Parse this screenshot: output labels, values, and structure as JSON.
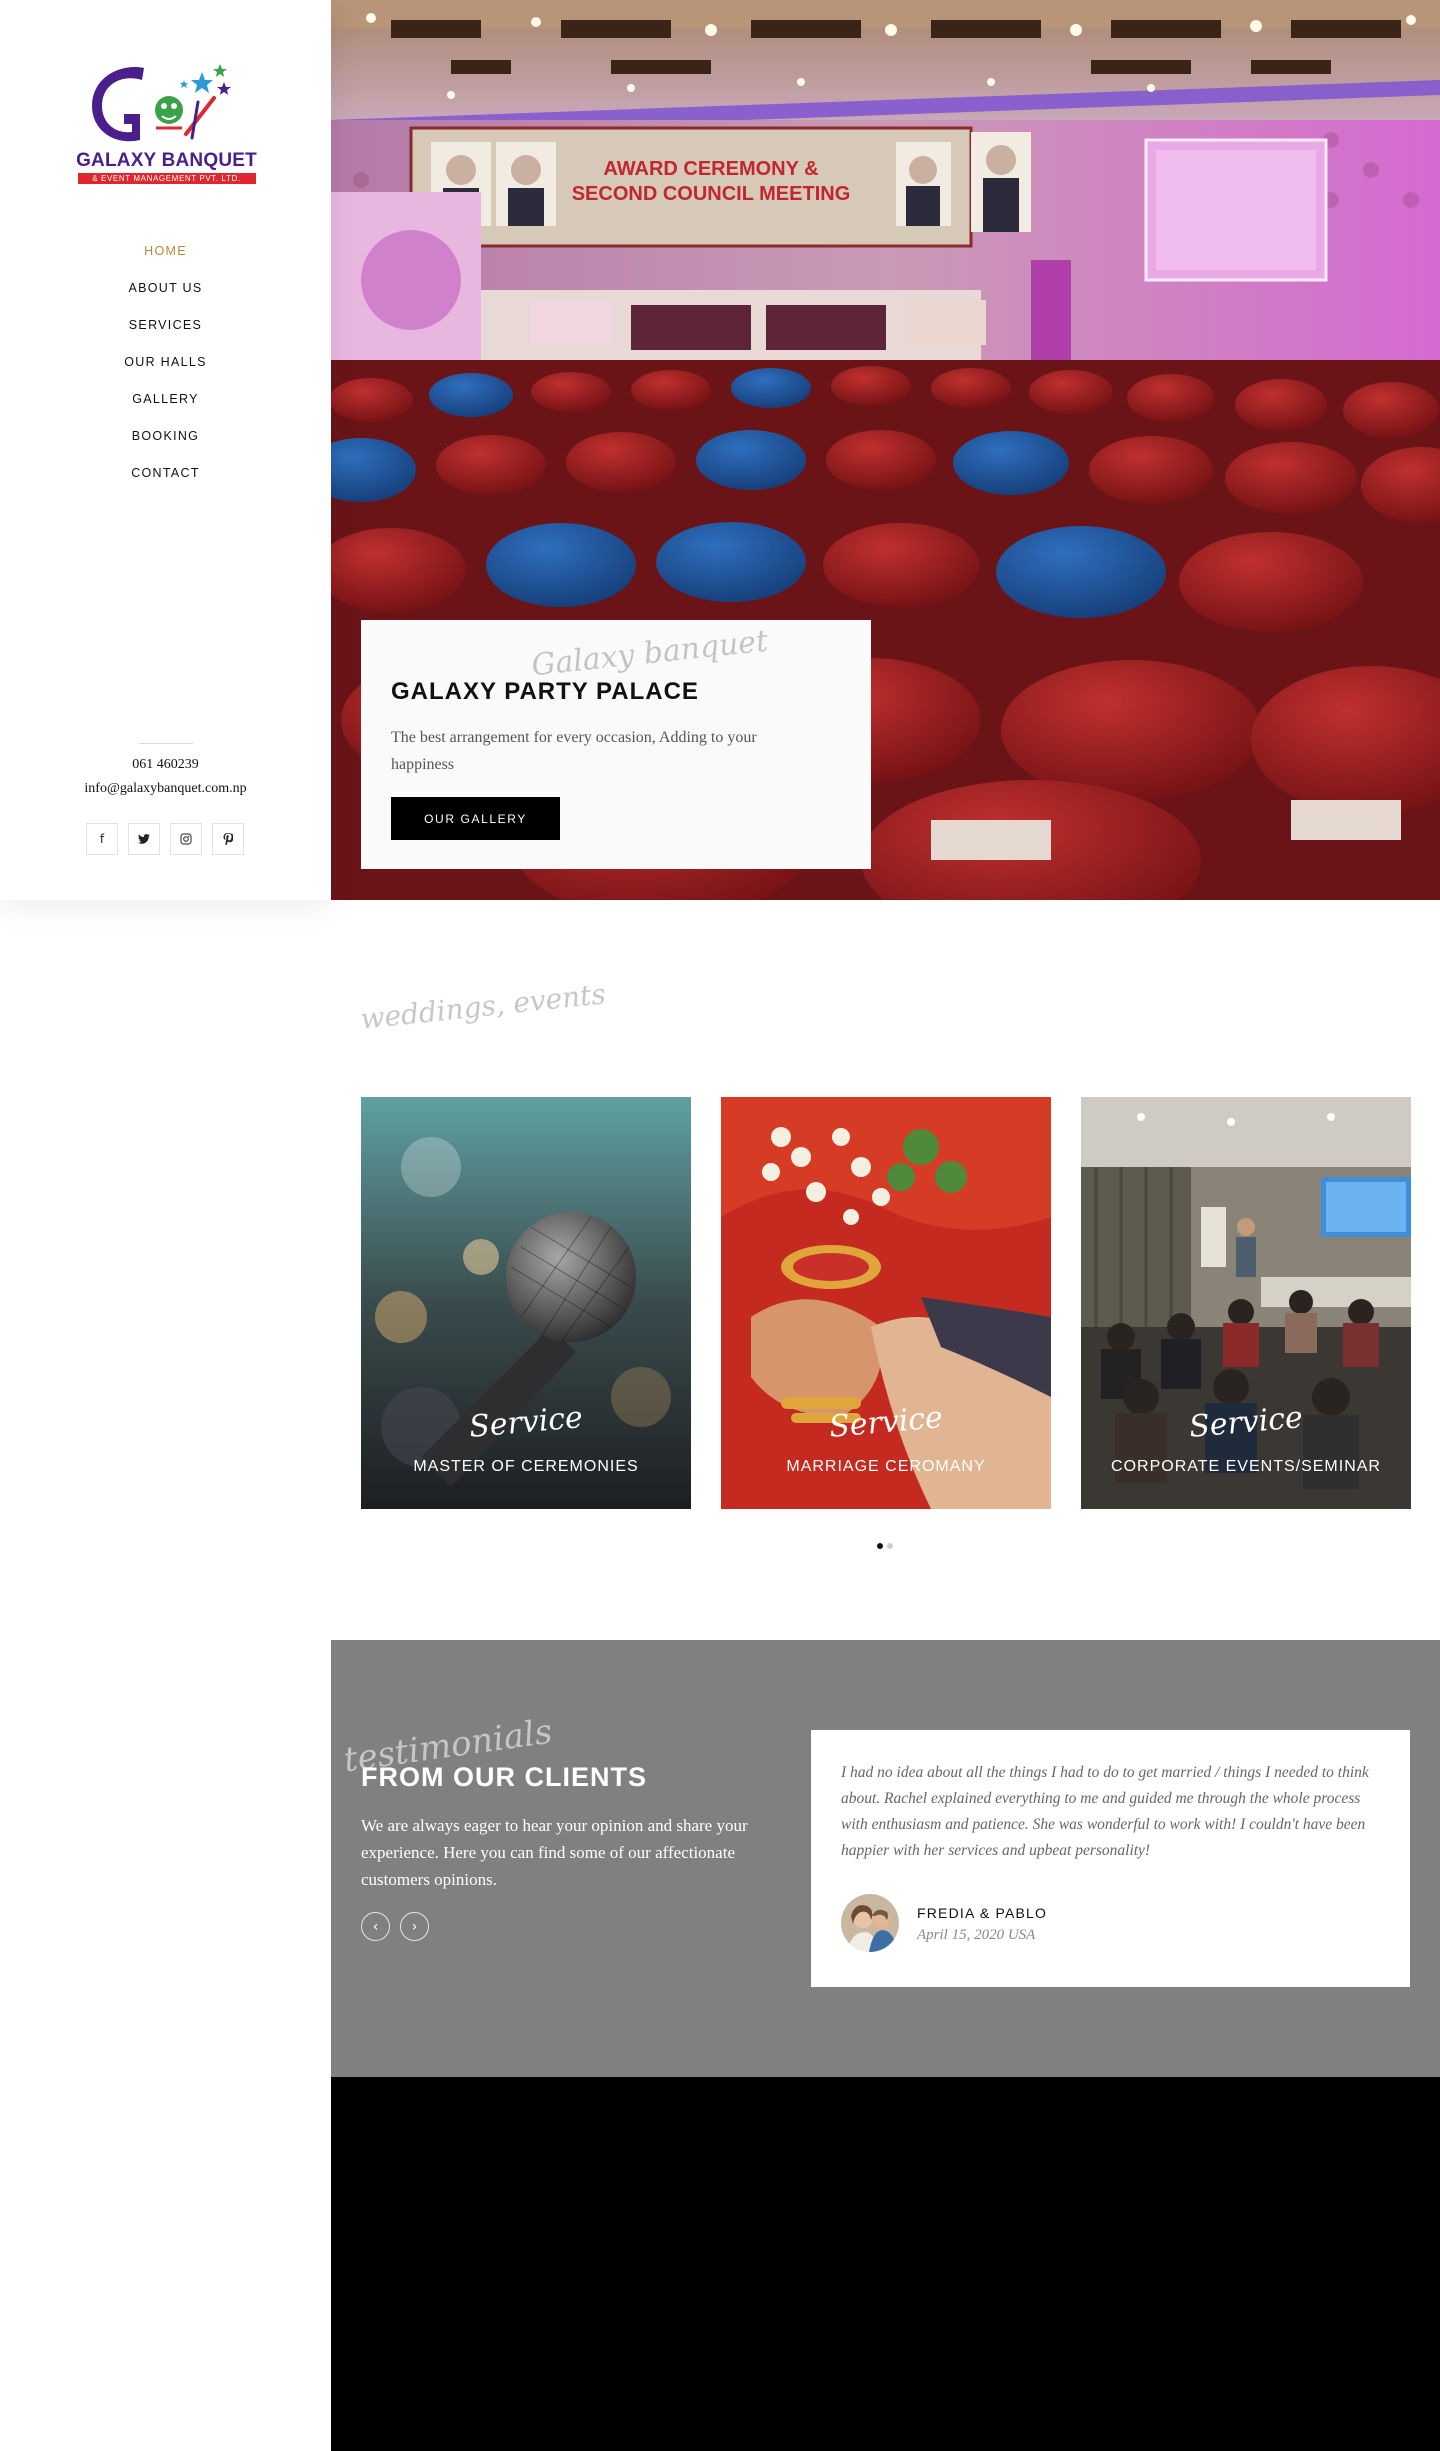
{
  "brand": {
    "logo_title": "GALAXY BANQUET",
    "logo_subtitle": "& EVENT MANAGEMENT PVT. LTD.",
    "colors": {
      "purple": "#4a1f8c",
      "red": "#e0262e",
      "gold": "#b58a3f"
    }
  },
  "nav": {
    "items": [
      {
        "label": "HOME",
        "active": true
      },
      {
        "label": "ABOUT US"
      },
      {
        "label": "SERVICES"
      },
      {
        "label": "OUR HALLS"
      },
      {
        "label": "GALLERY"
      },
      {
        "label": "BOOKING"
      },
      {
        "label": "CONTACT"
      }
    ]
  },
  "contact": {
    "phone": "061 460239",
    "email": "info@galaxybanquet.com.np",
    "socials": [
      {
        "icon": "facebook-icon",
        "glyph": "f"
      },
      {
        "icon": "twitter-icon",
        "glyph": "t"
      },
      {
        "icon": "instagram-icon",
        "glyph": "◎"
      },
      {
        "icon": "pinterest-icon",
        "glyph": "p"
      }
    ]
  },
  "hero": {
    "script": "Galaxy banquet",
    "title": "GALAXY PARTY PALACE",
    "text": "The best arrangement for every occasion, Adding to your happiness",
    "button": "OUR GALLERY",
    "banner_line1": "AWARD CEREMONY &",
    "banner_line2": "SECOND COUNCIL MEETING"
  },
  "services": {
    "script": "weddings, events",
    "cards": [
      {
        "script": "Service",
        "title": "MASTER OF CEREMONIES"
      },
      {
        "script": "Service",
        "title": "MARRIAGE CEROMANY"
      },
      {
        "script": "Service",
        "title": "CORPORATE EVENTS/SEMINAR"
      }
    ]
  },
  "testimonials": {
    "script": "testimonials",
    "title": "FROM OUR CLIENTS",
    "text": "We are always eager to hear your opinion and share your experience. Here you can find some of our affectionate customers opinions.",
    "prev": "‹",
    "next": "›",
    "quote": "I had no idea about all the things I had to do to get married / things I needed to think about. Rachel explained everything to me and guided me through the whole process with enthusiasm and patience. She was wonderful to work with! I couldn't have been happier with her services and upbeat personality!",
    "name": "FREDIA & PABLO",
    "date": "April 15, 2020 USA"
  }
}
